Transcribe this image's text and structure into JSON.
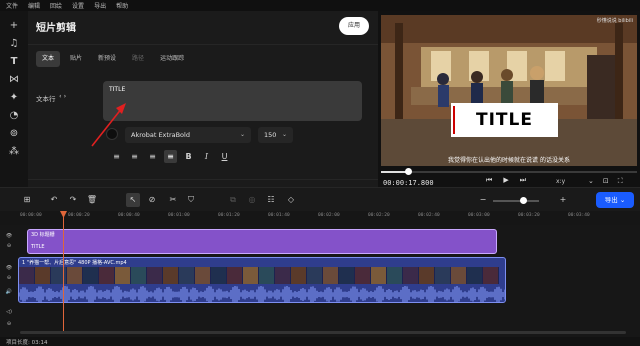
{
  "menu": [
    "文件",
    "编辑",
    "回绘",
    "设置",
    "导出",
    "帮助"
  ],
  "left_tools": [
    "plus-icon",
    "music-note-icon",
    "text-tool-icon",
    "transition-icon",
    "effects-icon",
    "sticker-icon",
    "filter-icon",
    "adjust-icon"
  ],
  "panel": {
    "title": "短片剪辑",
    "apply_label": "应用",
    "tabs": [
      {
        "label": "文本",
        "state": "active"
      },
      {
        "label": "贴片",
        "state": "normal"
      },
      {
        "label": "新预设",
        "state": "normal"
      },
      {
        "label": "路径",
        "state": "disabled"
      },
      {
        "label": "运动跟踪",
        "state": "normal"
      }
    ],
    "text_line_label": "文本行",
    "text_line_arrows": "‹ ›",
    "input_value": "TITLE",
    "font": "Akrobat ExtraBold",
    "font_size": "150"
  },
  "preview": {
    "watermark": "秒懂说说 bilibili",
    "overlay_title": "TITLE",
    "subtitle": "我觉得你在认出他的时候就在说谎 的话没关系",
    "timecode": "00:00:17.800",
    "progress": 0.105,
    "xy_label": "x:y"
  },
  "timeline": {
    "export_label": "导出",
    "ruler_labels": [
      "00:00:00",
      "00:00:20",
      "00:00:40",
      "00:01:00",
      "00:01:20",
      "00:01:40",
      "00:02:00",
      "00:02:20",
      "00:02:40",
      "00:03:00",
      "00:03:20",
      "00:03:40"
    ],
    "text_clip": {
      "name": "3D 标题栅",
      "title": "TITLE"
    },
    "video_clip": {
      "name": "1 \"养猫一帮、片后意思\" 480P 播格-AVC.mp4"
    },
    "zoom_level": 0.65
  },
  "status": {
    "text": "项目长度: 03:14"
  },
  "colors": {
    "accent": "#1a5cff",
    "text_clip": "#8452c9",
    "video_clip": "#2f3d8d",
    "playhead": "#e0663a"
  }
}
